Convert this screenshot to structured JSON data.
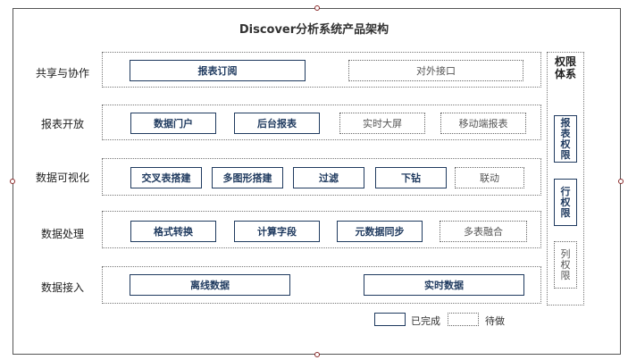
{
  "title": "Discover分析系统产品架构",
  "rows": [
    {
      "label": "共享与协作",
      "items": [
        {
          "text": "报表订阅",
          "status": "done"
        },
        {
          "text": "对外接口",
          "status": "todo"
        }
      ]
    },
    {
      "label": "报表开放",
      "items": [
        {
          "text": "数据门户",
          "status": "done"
        },
        {
          "text": "后台报表",
          "status": "done"
        },
        {
          "text": "实时大屏",
          "status": "todo"
        },
        {
          "text": "移动端报表",
          "status": "todo"
        }
      ]
    },
    {
      "label": "数据可视化",
      "items": [
        {
          "text": "交叉表搭建",
          "status": "done"
        },
        {
          "text": "多图形搭建",
          "status": "done"
        },
        {
          "text": "过滤",
          "status": "done"
        },
        {
          "text": "下钻",
          "status": "done"
        },
        {
          "text": "联动",
          "status": "todo"
        }
      ]
    },
    {
      "label": "数据处理",
      "items": [
        {
          "text": "格式转换",
          "status": "done"
        },
        {
          "text": "计算字段",
          "status": "done"
        },
        {
          "text": "元数据同步",
          "status": "done"
        },
        {
          "text": "多表融合",
          "status": "todo"
        }
      ]
    },
    {
      "label": "数据接入",
      "items": [
        {
          "text": "离线数据",
          "status": "done"
        },
        {
          "text": "实时数据",
          "status": "done"
        }
      ]
    }
  ],
  "permission": {
    "title": "权限体系",
    "items": [
      {
        "text": "报表权限",
        "status": "done"
      },
      {
        "text": "行权限",
        "status": "done"
      },
      {
        "text": "列权限",
        "status": "todo"
      }
    ]
  },
  "legend": {
    "done": "已完成",
    "todo": "待做"
  }
}
